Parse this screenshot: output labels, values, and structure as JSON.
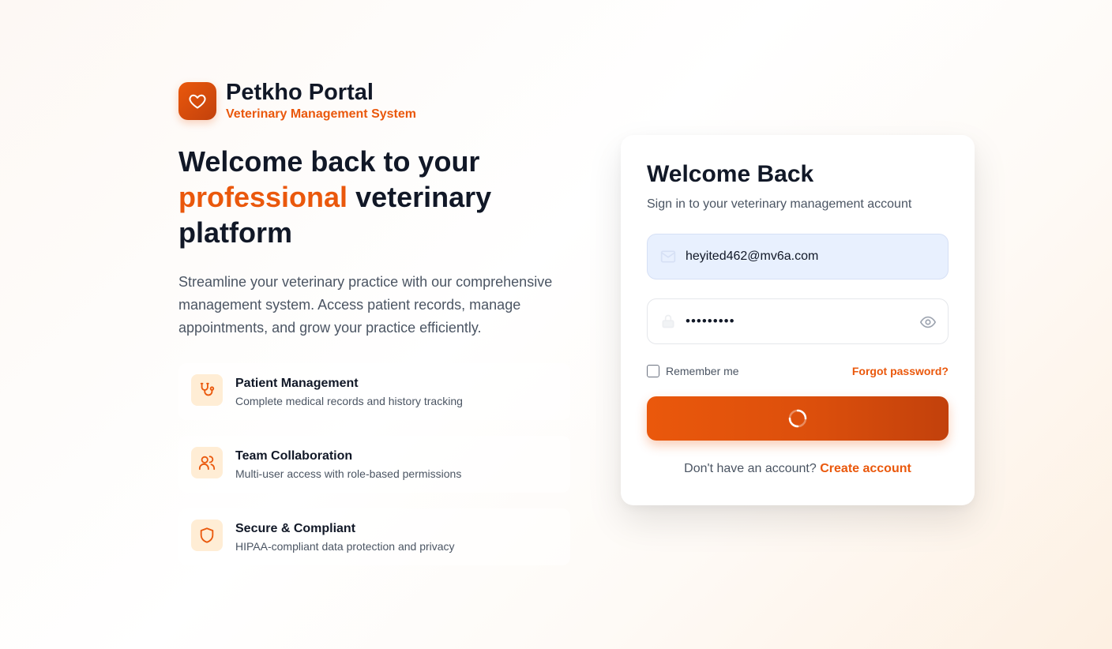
{
  "brand": {
    "title": "Petkho Portal",
    "subtitle": "Veterinary Management System",
    "logo_icon": "heart-icon"
  },
  "hero": {
    "headline_part1": "Welcome back to your",
    "headline_accent": "professional",
    "headline_part2": "veterinary",
    "headline_part3": "platform",
    "description": "Streamline your veterinary practice with our comprehensive management system. Access patient records, manage appointments, and grow your practice efficiently."
  },
  "features": [
    {
      "title": "Patient Management",
      "description": "Complete medical records and history tracking",
      "icon": "stethoscope-icon"
    },
    {
      "title": "Team Collaboration",
      "description": "Multi-user access with role-based permissions",
      "icon": "users-icon"
    },
    {
      "title": "Secure & Compliant",
      "description": "HIPAA-compliant data protection and privacy",
      "icon": "shield-icon"
    }
  ],
  "login": {
    "title": "Welcome Back",
    "subtitle": "Sign in to your veterinary management account",
    "email_value": "heyited462@mv6a.com",
    "password_value": "•••••••••",
    "remember_label": "Remember me",
    "forgot_label": "Forgot password?",
    "submit_state": "loading",
    "no_account_text": "Don't have an account?",
    "create_account_label": "Create account"
  },
  "colors": {
    "accent": "#ea580c",
    "accent_dark": "#c2410c",
    "icon_bg": "#ffedd5",
    "autofill_bg": "#e8f0fe"
  }
}
